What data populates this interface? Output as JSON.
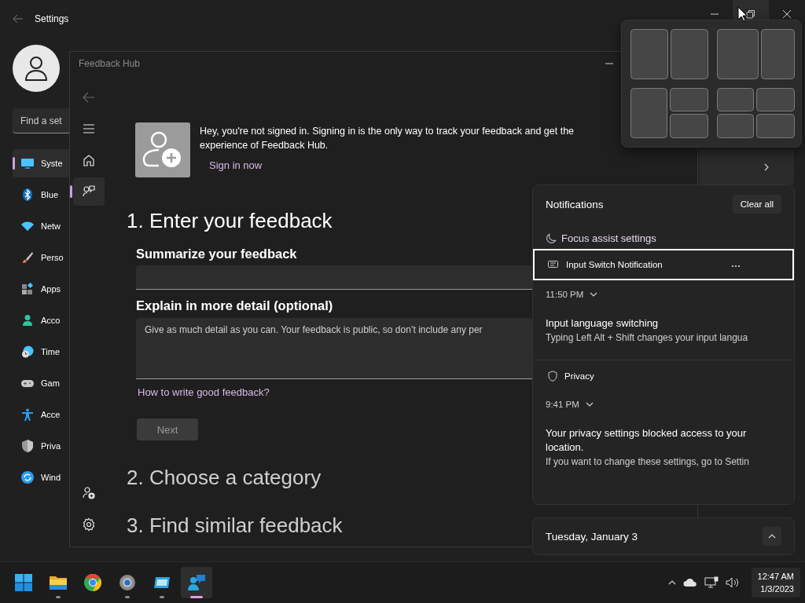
{
  "settings_window": {
    "title": "Settings",
    "controls": [
      {
        "kind": "minimize",
        "hovered": false
      },
      {
        "kind": "maximize",
        "hovered": true
      },
      {
        "kind": "close",
        "hovered": false
      }
    ],
    "search": {
      "placeholder": "Find a set"
    },
    "nav_items": [
      {
        "kind": "system",
        "label": "Syste",
        "selected": true
      },
      {
        "kind": "bluetooth",
        "label": "Blue",
        "selected": false
      },
      {
        "kind": "network",
        "label": "Netw",
        "selected": false
      },
      {
        "kind": "personalization",
        "label": "Perso",
        "selected": false
      },
      {
        "kind": "apps",
        "label": "Apps",
        "selected": false
      },
      {
        "kind": "accounts",
        "label": "Acco",
        "selected": false
      },
      {
        "kind": "time",
        "label": "Time",
        "selected": false
      },
      {
        "kind": "gaming",
        "label": "Gam",
        "selected": false
      },
      {
        "kind": "accessibility",
        "label": "Acce",
        "selected": false
      },
      {
        "kind": "privacy",
        "label": "Priva",
        "selected": false
      },
      {
        "kind": "update",
        "label": "Wind",
        "selected": false
      }
    ]
  },
  "feedback_hub": {
    "title": "Feedback Hub",
    "rail_top": [
      {
        "kind": "menu",
        "selected": false
      },
      {
        "kind": "home",
        "selected": false
      },
      {
        "kind": "feedback",
        "selected": true
      }
    ],
    "rail_bottom": [
      {
        "kind": "add_user",
        "selected": false
      },
      {
        "kind": "settings",
        "selected": false
      }
    ],
    "banner": {
      "text": "Hey, you're not signed in. Signing in is the only way to track your feedback and get the experience of Feedback Hub.",
      "link": "Sign in now"
    },
    "step_1": {
      "heading": "1. Enter your feedback",
      "summary_label": "Summarize your feedback",
      "detail_label": "Explain in more detail (optional)",
      "detail_placeholder": "Give as much detail as you can. Your feedback is public, so don’t include any per",
      "help_link": "How to write good feedback?",
      "next_button": {
        "label": "Next",
        "disabled": true
      }
    },
    "steps": [
      "2. Choose a category",
      "3. Find similar feedback"
    ]
  },
  "notifications": {
    "title": "Notifications",
    "clear_button": "Clear all",
    "focus_assist": "Focus assist settings",
    "groups": [
      {
        "app": "Input Switch Notification",
        "kind": "keyboard",
        "focused": true,
        "items": [
          {
            "time": "11:50 PM",
            "title": "Input language switching",
            "body": "Typing Left Alt + Shift changes your input langua"
          }
        ]
      },
      {
        "app": "Privacy",
        "kind": "shield",
        "focused": false,
        "items": [
          {
            "time": "9:41 PM",
            "title": "Your privacy settings blocked access to your location.",
            "body": "If you want to change these settings, go to Settin"
          }
        ]
      }
    ]
  },
  "calendar": {
    "date": "Tuesday, January 3"
  },
  "taskbar": {
    "apps": [
      {
        "kind": "start",
        "running": false,
        "selected": false
      },
      {
        "kind": "folder",
        "running": true,
        "selected": false
      },
      {
        "kind": "browser",
        "running": false,
        "selected": false
      },
      {
        "kind": "settings",
        "running": true,
        "selected": false
      },
      {
        "kind": "remote",
        "running": true,
        "selected": false
      },
      {
        "kind": "feedback",
        "running": true,
        "selected": true
      }
    ],
    "time": "12:47 AM",
    "date": "1/3/2023"
  }
}
